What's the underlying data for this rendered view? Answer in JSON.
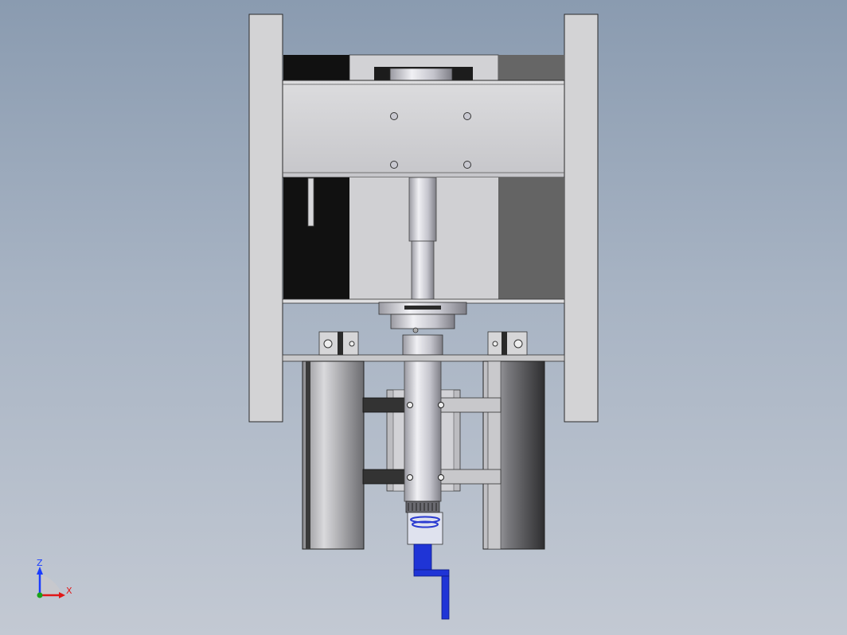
{
  "triad": {
    "z_label": "Z",
    "x_label": "X"
  },
  "colors": {
    "background_top": "#8a9bb0",
    "background_bottom": "#c3c9d3",
    "part_light": "#d4d4d6",
    "part_dark": "#111111",
    "part_mid": "#666666",
    "handle_blue": "#1f34d6",
    "triad_z": "#1a3cff",
    "triad_x": "#e01818",
    "triad_y": "#1aa21a"
  }
}
